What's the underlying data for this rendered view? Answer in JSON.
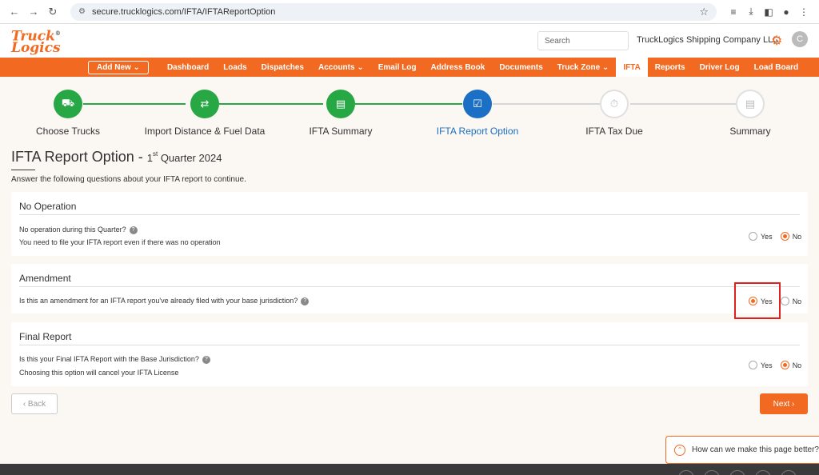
{
  "browser": {
    "url": "secure.trucklogics.com/IFTA/IFTAReportOption"
  },
  "header": {
    "logo_line1": "Truck",
    "logo_line2": "Logics",
    "logo_mark": "®",
    "search_placeholder": "Search",
    "company": "TruckLogics Shipping Company LLC",
    "avatar_letter": "C"
  },
  "nav": {
    "add_new": "Add New",
    "items": [
      "Dashboard",
      "Loads",
      "Dispatches",
      "Accounts",
      "Email Log",
      "Address Book",
      "Documents",
      "Truck Zone",
      "IFTA",
      "Reports",
      "Driver Log",
      "Load Board"
    ],
    "active": "IFTA"
  },
  "steps": [
    {
      "label": "Choose Trucks",
      "state": "done"
    },
    {
      "label": "Import Distance & Fuel Data",
      "state": "done"
    },
    {
      "label": "IFTA Summary",
      "state": "done"
    },
    {
      "label": "IFTA Report Option",
      "state": "current"
    },
    {
      "label": "IFTA Tax Due",
      "state": "todo"
    },
    {
      "label": "Summary",
      "state": "todo"
    }
  ],
  "page": {
    "title": "IFTA Report Option - ",
    "quarter_num": "1",
    "quarter_sup": "st",
    "quarter_text": " Quarter 2024",
    "instructions": "Answer the following questions about your IFTA report to continue."
  },
  "sections": {
    "no_operation": {
      "title": "No Operation",
      "question": "No operation during this Quarter?",
      "hint": "You need to file your IFTA report even if there was no operation",
      "yes": "Yes",
      "no": "No",
      "selected": "No"
    },
    "amendment": {
      "title": "Amendment",
      "question": "Is this an amendment for an IFTA report you've already filed with your base jurisdiction?",
      "yes": "Yes",
      "no": "No",
      "selected": "Yes"
    },
    "final_report": {
      "title": "Final Report",
      "question": "Is this your Final IFTA Report with the Base Jurisdiction?",
      "hint": "Choosing this option will cancel your IFTA License",
      "yes": "Yes",
      "no": "No",
      "selected": "No"
    }
  },
  "buttons": {
    "back": "‹ Back",
    "next": "Next ›"
  },
  "feedback": {
    "text": "How can we make this page better?"
  },
  "colors": {
    "brand": "#f26a21",
    "step_done": "#28a745",
    "step_current": "#1b6fc4",
    "highlight": "#e0221f"
  }
}
